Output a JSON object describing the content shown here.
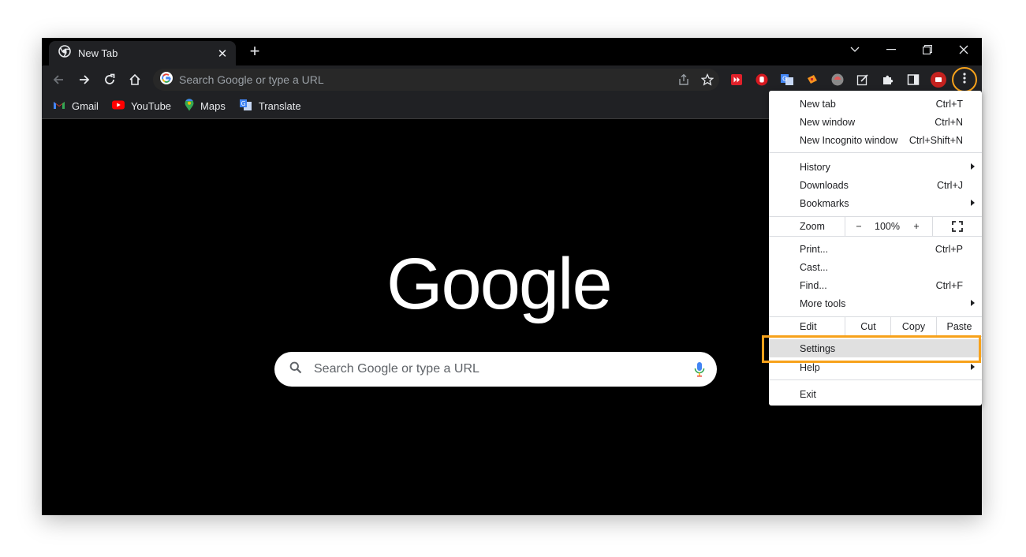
{
  "tab": {
    "title": "New Tab",
    "close": "✕"
  },
  "newtab": "+",
  "omnibox": {
    "placeholder": "Search Google or type a URL"
  },
  "bookmarks": [
    {
      "label": "Gmail"
    },
    {
      "label": "YouTube"
    },
    {
      "label": "Maps"
    },
    {
      "label": "Translate"
    }
  ],
  "logo": "Google",
  "search": {
    "placeholder": "Search Google or type a URL"
  },
  "menu": {
    "new_tab": {
      "label": "New tab",
      "shortcut": "Ctrl+T"
    },
    "new_window": {
      "label": "New window",
      "shortcut": "Ctrl+N"
    },
    "new_incognito": {
      "label": "New Incognito window",
      "shortcut": "Ctrl+Shift+N"
    },
    "history": {
      "label": "History"
    },
    "downloads": {
      "label": "Downloads",
      "shortcut": "Ctrl+J"
    },
    "bookmarks": {
      "label": "Bookmarks"
    },
    "zoom": {
      "label": "Zoom",
      "minus": "−",
      "value": "100%",
      "plus": "+"
    },
    "print": {
      "label": "Print...",
      "shortcut": "Ctrl+P"
    },
    "cast": {
      "label": "Cast..."
    },
    "find": {
      "label": "Find...",
      "shortcut": "Ctrl+F"
    },
    "more_tools": {
      "label": "More tools"
    },
    "edit": {
      "label": "Edit",
      "cut": "Cut",
      "copy": "Copy",
      "paste": "Paste"
    },
    "settings": {
      "label": "Settings"
    },
    "help": {
      "label": "Help"
    },
    "exit": {
      "label": "Exit"
    }
  },
  "colors": {
    "highlight": "#f7a21b",
    "dark_bg": "#000000",
    "toolbar_bg": "#202124"
  }
}
